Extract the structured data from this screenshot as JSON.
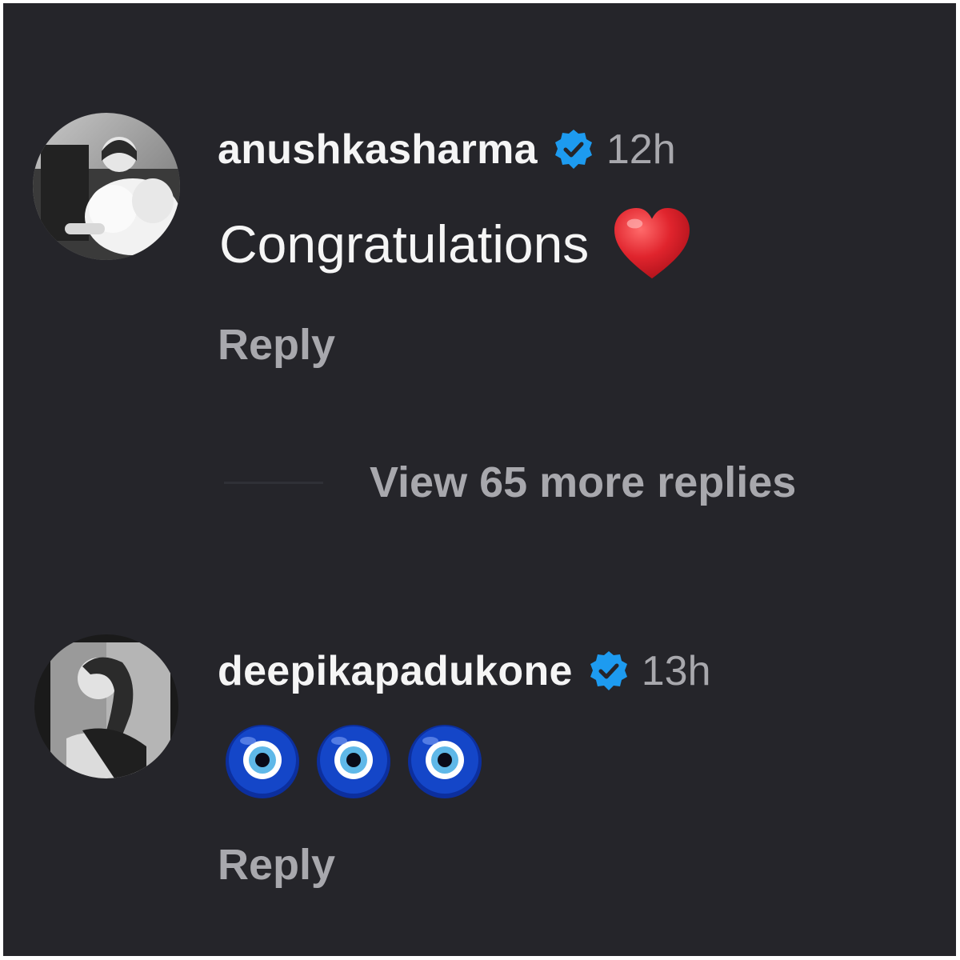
{
  "comments": [
    {
      "username": "anushkasharma",
      "verified_icon": "verified-badge-icon",
      "timestamp": "12h",
      "text": "Congratulations",
      "emoji": "red-heart-emoji",
      "reply_label": "Reply"
    },
    {
      "username": "deepikapadukone",
      "verified_icon": "verified-badge-icon",
      "timestamp": "13h",
      "text": "🧿🧿🧿",
      "emoji": "nazar-amulet-emoji",
      "reply_label": "Reply"
    }
  ],
  "view_more": {
    "label": "View 65 more replies"
  },
  "colors": {
    "background": "#25252a",
    "primary_text": "#f5f5f5",
    "secondary_text": "#a8a8ad",
    "verified_blue": "#1d9bf0",
    "heart_red": "#e0242d",
    "nazar_blue": "#1446c8"
  }
}
